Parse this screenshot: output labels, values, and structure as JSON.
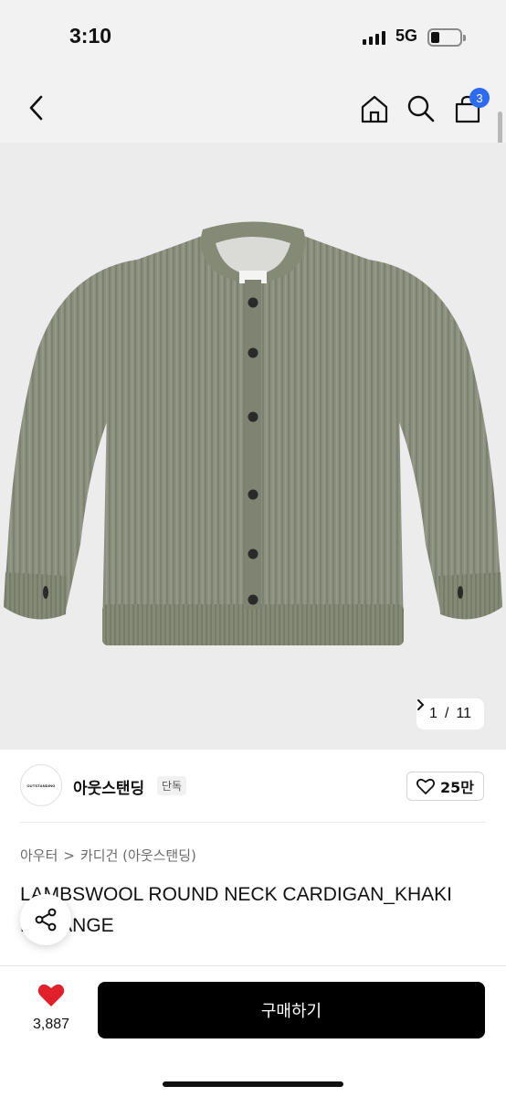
{
  "status_bar": {
    "time": "3:10",
    "network": "5G"
  },
  "nav": {
    "cart_count": "3"
  },
  "gallery": {
    "current": "1",
    "separator": "/",
    "total": "11",
    "next_icon": "chevron-right-icon"
  },
  "brand": {
    "logo_text": "OUTSTANDING",
    "name": "아웃스탠딩",
    "tag": "단독",
    "likes": "25만"
  },
  "breadcrumb": {
    "category": "아우터",
    "separator": ">",
    "subcategory": "카디건 (아웃스탠딩)"
  },
  "product": {
    "title": "LAMBSWOOL ROUND NECK CARDIGAN_KHAKI MELANGE"
  },
  "bottom_bar": {
    "wish_count": "3,887",
    "buy_label": "구매하기"
  },
  "colors": {
    "accent": "#2f6bf2",
    "heart": "#e0202b",
    "sweater": "#8b8f7d",
    "buy_button": "#000000"
  }
}
